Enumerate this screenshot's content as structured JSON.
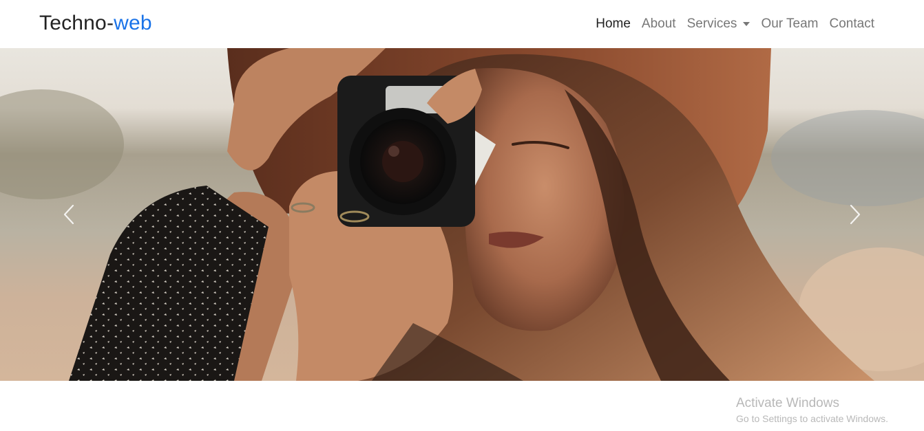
{
  "navbar": {
    "brand_main": "Techno-",
    "brand_accent": "web",
    "links": [
      {
        "label": "Home",
        "active": true
      },
      {
        "label": "About",
        "active": false
      },
      {
        "label": "Services",
        "active": false,
        "dropdown": true
      },
      {
        "label": "Our Team",
        "active": false
      },
      {
        "label": "Contact",
        "active": false
      }
    ]
  },
  "carousel": {
    "image": "woman-with-camera-photo",
    "prev_icon": "chevron-left-icon",
    "next_icon": "chevron-right-icon"
  },
  "watermark": {
    "title": "Activate Windows",
    "subtitle": "Go to Settings to activate Windows."
  },
  "colors": {
    "accent": "#1a73e8",
    "nav_text": "#777777",
    "nav_active": "#222222"
  }
}
